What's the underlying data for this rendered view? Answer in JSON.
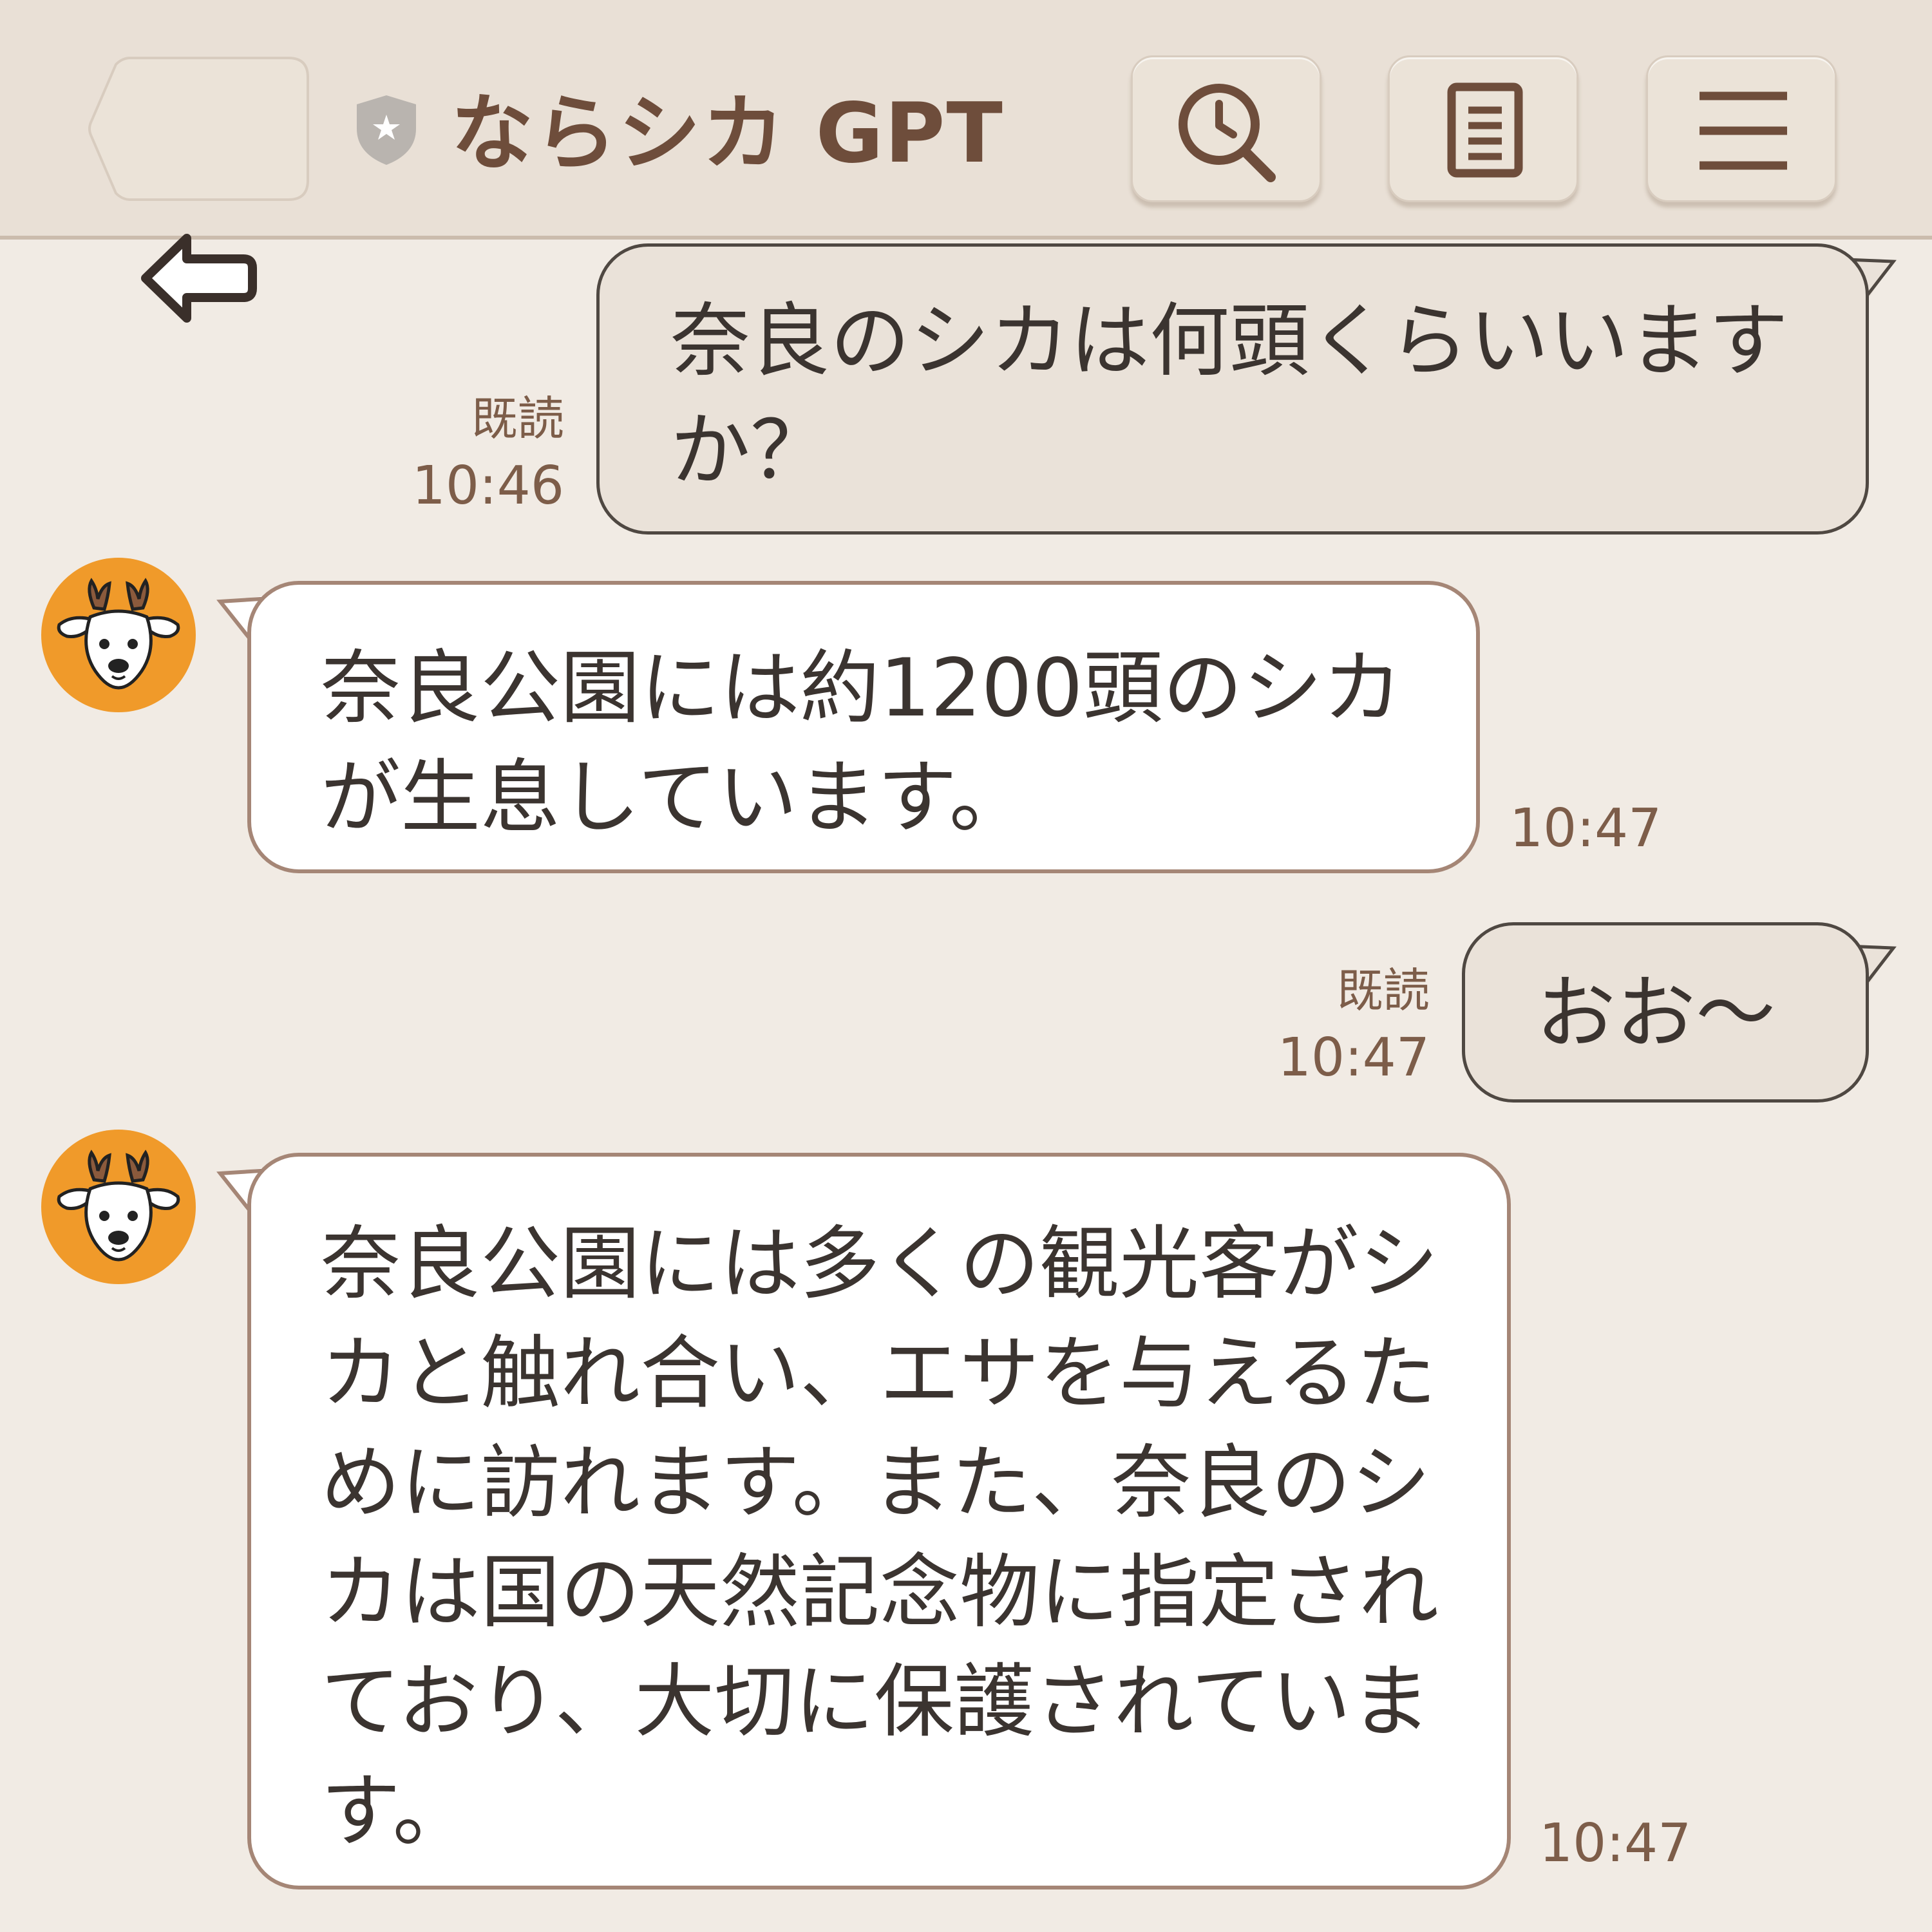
{
  "header": {
    "title": "ならシカ GPT",
    "back_icon": "arrow-left-icon",
    "badge_icon": "shield-star-icon",
    "search_icon": "history-search-icon",
    "doc_icon": "document-icon",
    "menu_icon": "hamburger-menu-icon"
  },
  "colors": {
    "background": "#f1ebe4",
    "header": "#e9e0d6",
    "title": "#6e4d3b",
    "outgoing_bubble": "#eae2d9",
    "incoming_bubble": "#ffffff",
    "incoming_border": "#a58676",
    "meta_text": "#7d5d49",
    "avatar": "#f09a2a"
  },
  "messages": [
    {
      "direction": "outgoing",
      "text": "奈良のシカは何頭くらいいますか？",
      "read": "既読",
      "time": "10:46"
    },
    {
      "direction": "incoming",
      "text": "奈良公園には約1200頭のシカが生息しています。",
      "time": "10:47"
    },
    {
      "direction": "outgoing",
      "text": "おお〜",
      "read": "既読",
      "time": "10:47"
    },
    {
      "direction": "incoming",
      "text": "奈良公園には多くの観光客がシカと触れ合い、エサを与えるために訪れます。また、奈良のシカは国の天然記念物に指定されており、大切に保護されています。",
      "time": "10:47"
    }
  ]
}
